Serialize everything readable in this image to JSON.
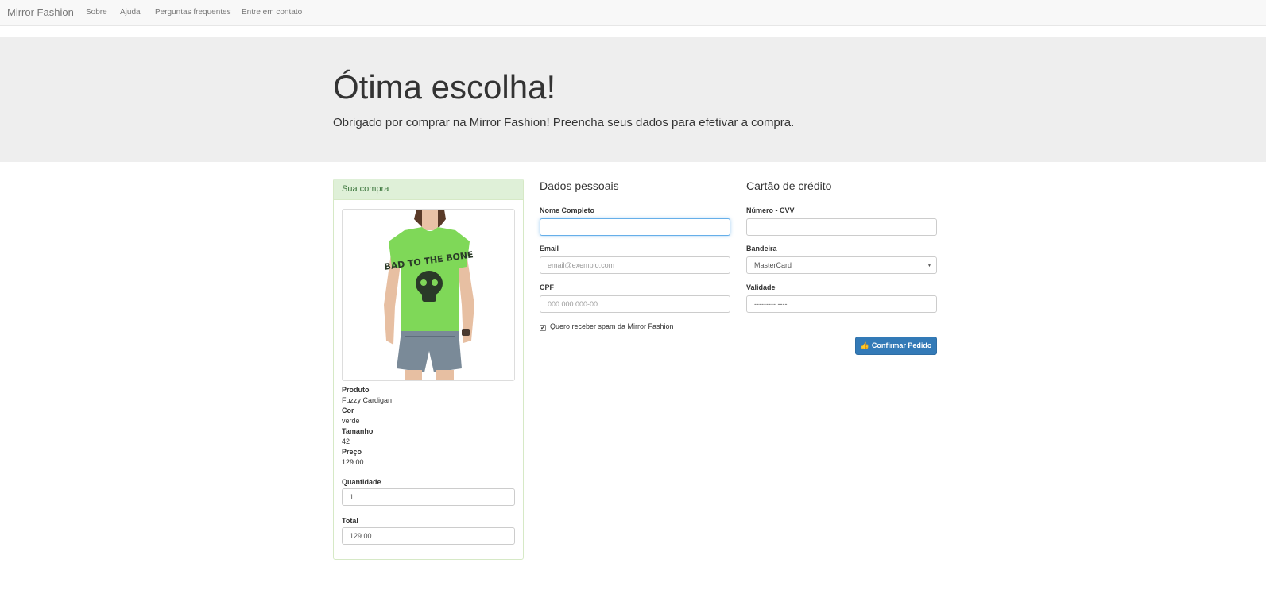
{
  "navbar": {
    "brand": "Mirror Fashion",
    "links": [
      "Sobre",
      "Ajuda",
      "Perguntas frequentes",
      "Entre em contato"
    ]
  },
  "jumbotron": {
    "title": "Ótima escolha!",
    "subtitle": "Obrigado por comprar na Mirror Fashion! Preencha seus dados para efetivar a compra."
  },
  "purchase": {
    "heading": "Sua compra",
    "image_graphic": "BAD TO THE BONE",
    "details": [
      {
        "label": "Produto",
        "value": "Fuzzy Cardigan"
      },
      {
        "label": "Cor",
        "value": "verde"
      },
      {
        "label": "Tamanho",
        "value": "42"
      },
      {
        "label": "Preço",
        "value": "129.00"
      }
    ],
    "quantity_label": "Quantidade",
    "quantity_value": "1",
    "total_label": "Total",
    "total_value": "129.00"
  },
  "personal": {
    "title": "Dados pessoais",
    "name_label": "Nome Completo",
    "name_value": "",
    "email_label": "Email",
    "email_placeholder": "email@exemplo.com",
    "cpf_label": "CPF",
    "cpf_placeholder": "000.000.000-00",
    "spam_checkbox_label": "Quero receber spam da Mirror Fashion",
    "spam_checked": true
  },
  "card": {
    "title": "Cartão de crédito",
    "number_label": "Número - CVV",
    "number_value": "",
    "brand_label": "Bandeira",
    "brand_selected": "MasterCard",
    "validity_label": "Validade",
    "validity_value": "--------- ----"
  },
  "confirm_button": "Confirmar Pedido",
  "colors": {
    "navbar_bg": "#f8f8f8",
    "jumbotron_bg": "#eeeeee",
    "panel_success_bg": "#dff0d8",
    "panel_success_text": "#3c763d",
    "primary": "#337ab7",
    "shirt_green": "#7fd858"
  }
}
